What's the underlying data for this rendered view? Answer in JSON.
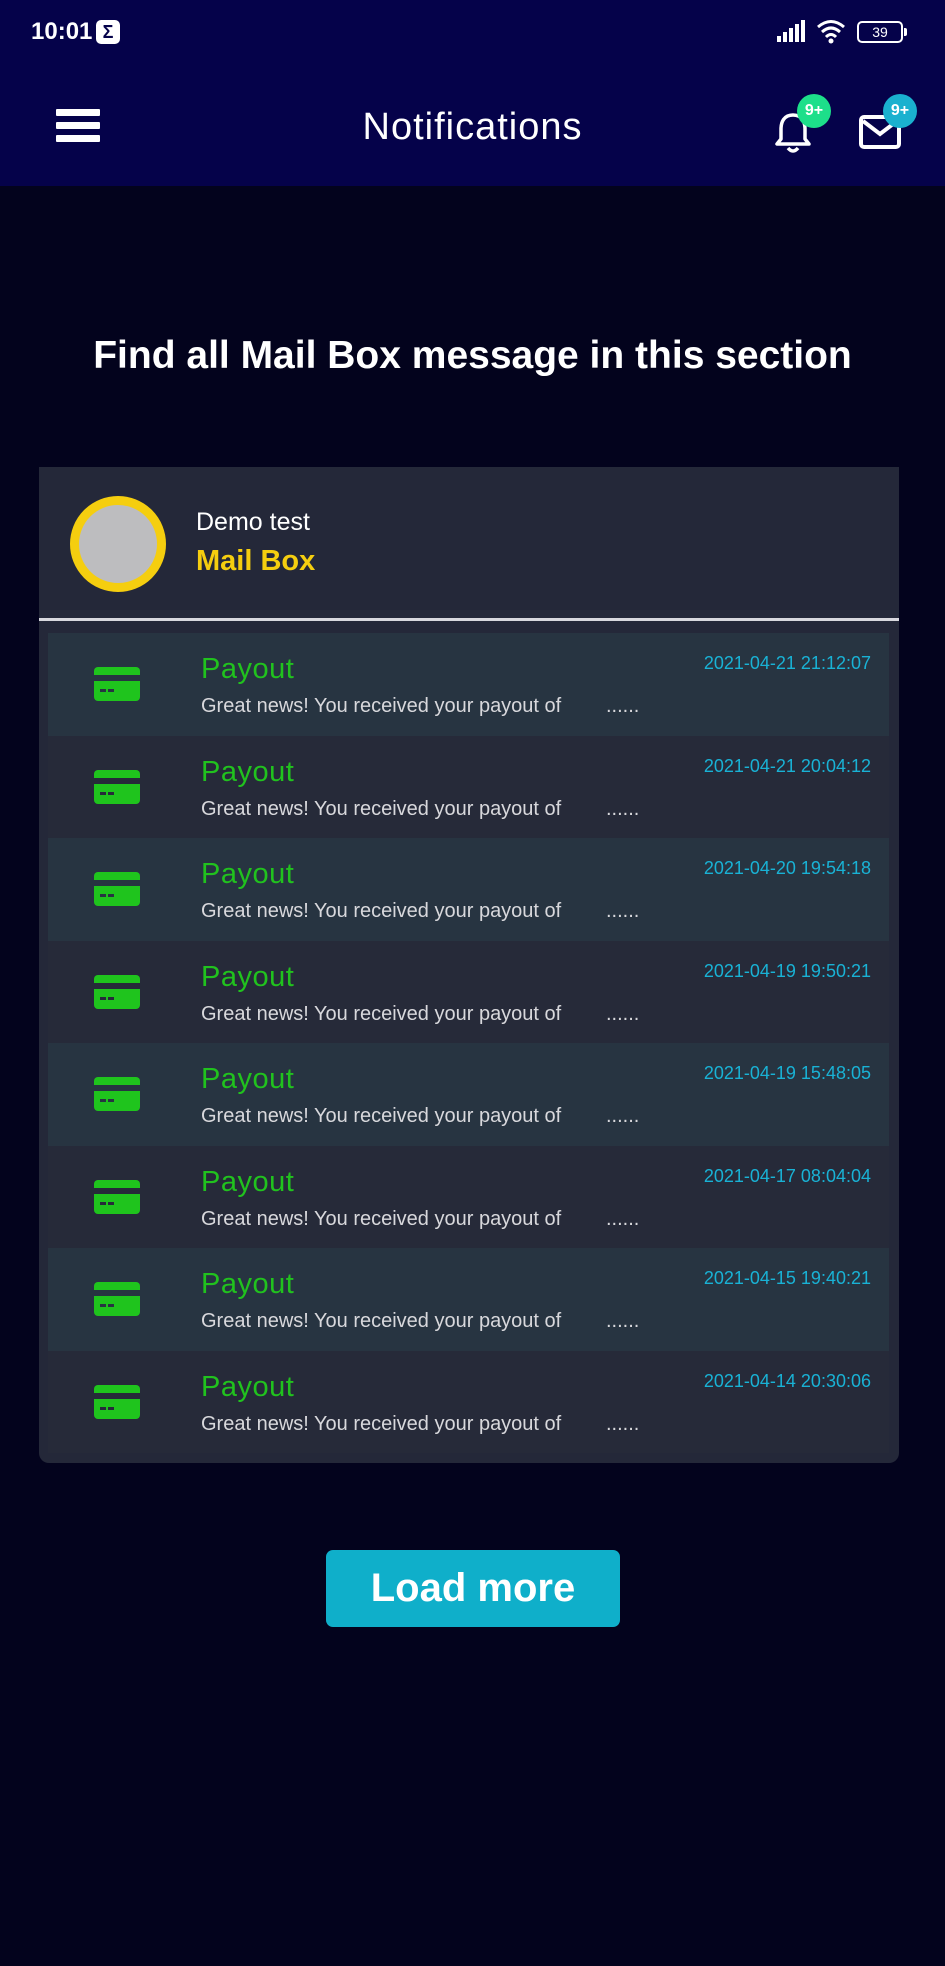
{
  "status_bar": {
    "time": "10:01",
    "app_icon": "Σ",
    "battery": "39"
  },
  "header": {
    "title": "Notifications",
    "bell_badge": "9+",
    "mail_badge": "9+",
    "bell_badge_color": "#1ddf8a",
    "mail_badge_color": "#1ab1cf"
  },
  "section_heading": "Find all Mail Box message in this section",
  "card": {
    "user_name": "Demo test",
    "mailbox_label": "Mail Box",
    "accent_color": "#f5ce0f"
  },
  "messages": [
    {
      "title": "Payout",
      "text": "Great news! You received your payout of",
      "ellipsis": "......",
      "date": "2021-04-21 21:12:07"
    },
    {
      "title": "Payout",
      "text": "Great news! You received your payout of",
      "ellipsis": "......",
      "date": "2021-04-21 20:04:12"
    },
    {
      "title": "Payout",
      "text": "Great news! You received your payout of",
      "ellipsis": "......",
      "date": "2021-04-20 19:54:18"
    },
    {
      "title": "Payout",
      "text": "Great news! You received your payout of",
      "ellipsis": "......",
      "date": "2021-04-19 19:50:21"
    },
    {
      "title": "Payout",
      "text": "Great news! You received your payout of",
      "ellipsis": "......",
      "date": "2021-04-19 15:48:05"
    },
    {
      "title": "Payout",
      "text": "Great news! You received your payout of",
      "ellipsis": "......",
      "date": "2021-04-17 08:04:04"
    },
    {
      "title": "Payout",
      "text": "Great news! You received your payout of",
      "ellipsis": "......",
      "date": "2021-04-15 19:40:21"
    },
    {
      "title": "Payout",
      "text": "Great news! You received your payout of",
      "ellipsis": "......",
      "date": "2021-04-14 20:30:06"
    }
  ],
  "load_more_label": "Load more",
  "icons": {
    "menu": "menu-icon",
    "bell": "bell-icon",
    "mail": "envelope-icon",
    "message": "credit-card-icon"
  }
}
